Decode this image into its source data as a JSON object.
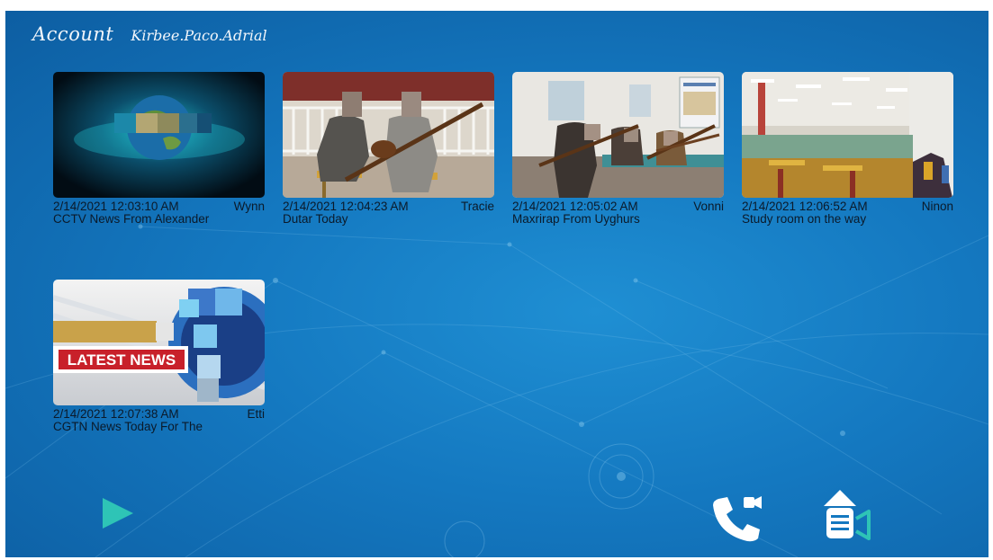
{
  "header": {
    "account_label": "Account",
    "user_name": "Kirbee.Paco.Adrial"
  },
  "videos": [
    {
      "date": "2/14/2021 12:03:10 AM",
      "author": "Wynn",
      "title": "CCTV News From Alexander",
      "thumb": "earth-globe"
    },
    {
      "date": "2/14/2021 12:04:23 AM",
      "author": "Tracie",
      "title": "Dutar Today",
      "thumb": "musicians-outdoor"
    },
    {
      "date": "2/14/2021 12:05:02 AM",
      "author": "Vonni",
      "title": "Maxrirap From Uyghurs",
      "thumb": "musicians-indoor"
    },
    {
      "date": "2/14/2021 12:06:52 AM",
      "author": "Ninon",
      "title": "Study room on the way",
      "thumb": "study-room"
    },
    {
      "date": "2/14/2021 12:07:38 AM",
      "author": "Etti",
      "title": "CGTN News Today For The",
      "thumb": "latest-news",
      "thumb_text": "LATEST NEWS"
    }
  ],
  "controls": {
    "play_icon": "play-icon",
    "video_call_icon": "video-call-icon",
    "upload_video_icon": "upload-video-icon"
  },
  "colors": {
    "accent_teal": "#2ec4b6",
    "icon_white": "#ffffff",
    "background": "#1478c0"
  }
}
